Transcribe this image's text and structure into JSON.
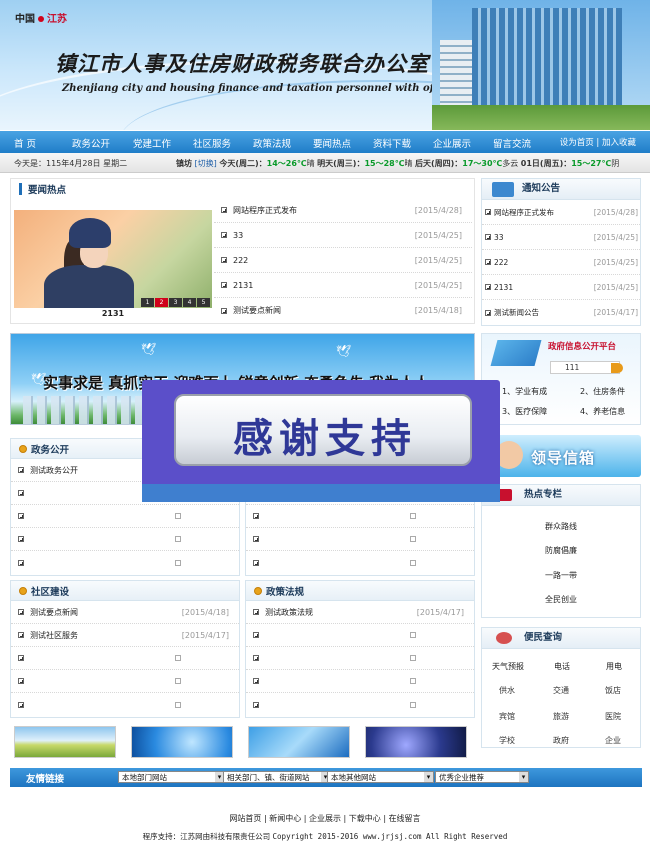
{
  "header": {
    "site_tag_a": "中国",
    "site_tag_b": "江苏",
    "cn_title": "镇江市人事及住房财政税务联合办公室",
    "en_title": "Zhenjiang city and housing finance and taxation personnel with office"
  },
  "nav": {
    "items": [
      "首 页",
      "政务公开",
      "党建工作",
      "社区服务",
      "政策法规",
      "要闻热点",
      "资料下载",
      "企业展示",
      "留言交流"
    ],
    "set_home": "设为首页",
    "add_fav": "加入收藏"
  },
  "infobar": {
    "date": "今天是：115年4月28日 星期二",
    "city": "镇坊",
    "switch": "[切换]",
    "w_today_label": "今天(周二)：",
    "w_today_temp": "14～26℃",
    "w_today_cond": "晴",
    "w_tom_label": "明天(周三)：",
    "w_tom_temp": "15～28℃",
    "w_tom_cond": "晴",
    "w_after_label": "后天(周四)：",
    "w_after_temp": "17～30℃",
    "w_after_cond": "多云",
    "w_d4_label": "01日(周五)：",
    "w_d4_temp": "15～27℃",
    "w_d4_cond": "阴"
  },
  "news": {
    "title": "要闻热点",
    "photo_caption": "2131",
    "pager": [
      "1",
      "2",
      "3",
      "4",
      "5"
    ],
    "items": [
      {
        "title": "网站程序正式发布",
        "date": "[2015/4/28]"
      },
      {
        "title": "33",
        "date": "[2015/4/25]"
      },
      {
        "title": "222",
        "date": "[2015/4/25]"
      },
      {
        "title": "2131",
        "date": "[2015/4/25]"
      },
      {
        "title": "测试要点新闻",
        "date": "[2015/4/18]"
      }
    ]
  },
  "notice": {
    "title": "通知公告",
    "items": [
      {
        "title": "网站程序正式发布",
        "date": "[2015/4/28]"
      },
      {
        "title": "33",
        "date": "[2015/4/25]"
      },
      {
        "title": "222",
        "date": "[2015/4/25]"
      },
      {
        "title": "2131",
        "date": "[2015/4/25]"
      },
      {
        "title": "测试新闻公告",
        "date": "[2015/4/17]"
      }
    ]
  },
  "slogan": {
    "text": "实事求是 真抓实干 迎难而上 锐意创新 奋勇争先 我为人人"
  },
  "overlay": {
    "text": "感谢支持"
  },
  "gov": {
    "title": "政府信息公开平台",
    "select_value": "111",
    "items": [
      "1、学业有成",
      "2、住房条件",
      "3、医疗保障",
      "4、养老信息"
    ]
  },
  "lead": {
    "text": "领导信箱"
  },
  "hot": {
    "title": "热点专栏",
    "items": [
      "群众路线",
      "防腐倡廉",
      "一路一带",
      "全民创业"
    ]
  },
  "convenience": {
    "title": "便民查询",
    "items": [
      "天气预报",
      "电话",
      "用电",
      "供水",
      "交通",
      "饭店",
      "宾馆",
      "旅游",
      "医院",
      "学校",
      "政府",
      "企业"
    ]
  },
  "gov_open": {
    "title": "政务公开",
    "items": [
      {
        "title": "测试政务公开",
        "date": ""
      }
    ]
  },
  "community": {
    "title": "社区建设",
    "items": [
      {
        "title": "测试要点新闻",
        "date": "[2015/4/18]"
      },
      {
        "title": "测试社区服务",
        "date": "[2015/4/17]"
      }
    ]
  },
  "policy": {
    "title": "政策法规",
    "items": [
      {
        "title": "测试政策法规",
        "date": "[2015/4/17]"
      }
    ]
  },
  "friend_links": {
    "title": "友情链接",
    "selects": [
      "本地部门网站",
      "相关部门、镇、街道网站",
      "本地其他网站",
      "优秀企业推荐"
    ]
  },
  "footer": {
    "nav": [
      "网站首页",
      "新闻中心",
      "企业展示",
      "下载中心",
      "在线留言"
    ],
    "support_label": "程序支持：",
    "company": "江苏网由科技有限责任公司",
    "copyright": "Copyright 2015-2016 www.jrjsj.com  All Right Reserved"
  },
  "colors": {
    "nav_blue": "#1f7dc8",
    "accent_red": "#c8102e",
    "overlay_purple": "#5b4fc9",
    "weather_green": "#0a9a2a"
  }
}
